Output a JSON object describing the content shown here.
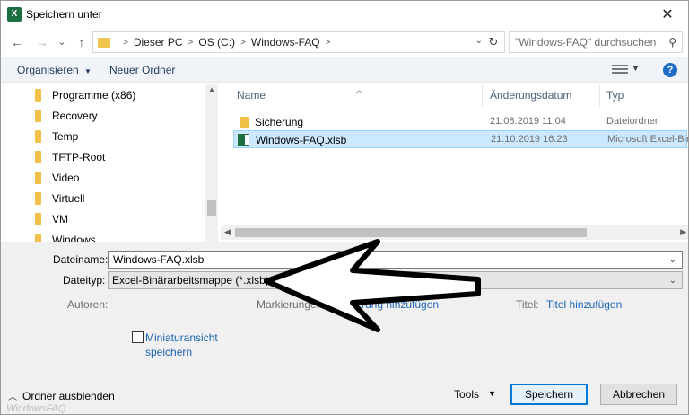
{
  "window": {
    "title": "Speichern unter",
    "close_glyph": "✕"
  },
  "nav": {
    "back": "←",
    "forward": "→",
    "recent": "⌄",
    "up": "↑",
    "breadcrumb": [
      "Dieser PC",
      "OS (C:)",
      "Windows-FAQ"
    ],
    "refresh": "↻",
    "search_placeholder": "\"Windows-FAQ\" durchsuchen"
  },
  "toolbar": {
    "organize": "Organisieren",
    "new_folder": "Neuer Ordner",
    "help": "?"
  },
  "tree": {
    "items": [
      "Programme (x86)",
      "Recovery",
      "Temp",
      "TFTP-Root",
      "Video",
      "Virtuell",
      "VM",
      "Windows"
    ]
  },
  "files": {
    "columns": {
      "name": "Name",
      "date": "Änderungsdatum",
      "type": "Typ"
    },
    "rows": [
      {
        "name": "Sicherung",
        "date": "21.08.2019 11:04",
        "type": "Dateiordner",
        "icon": "folder-icon"
      },
      {
        "name": "Windows-FAQ.xlsb",
        "date": "21.10.2019 16:23",
        "type": "Microsoft Excel-Bin",
        "icon": "excel-file-icon",
        "selected": true
      }
    ]
  },
  "form": {
    "filename_label": "Dateiname:",
    "filename_value": "Windows-FAQ.xlsb",
    "filetype_label": "Dateityp:",
    "filetype_value": "Excel-Binärarbeitsmappe (*.xlsb)",
    "authors_label": "Autoren:",
    "tags_label": "Markierungen:",
    "tags_link": "Markierung hinzufügen",
    "title_label": "Titel:",
    "title_link": "Titel hinzufügen",
    "thumbnail_line1": "Miniaturansicht",
    "thumbnail_line2": "speichern"
  },
  "bottom": {
    "hide_folders": "Ordner ausblenden",
    "tools": "Tools",
    "save": "Speichern",
    "cancel": "Abbrechen"
  },
  "watermark": "WindowsFAQ",
  "colors": {
    "accent": "#0078d7",
    "link": "#1b64b4",
    "selection": "#cce8ff",
    "excel": "#1d6f42"
  }
}
